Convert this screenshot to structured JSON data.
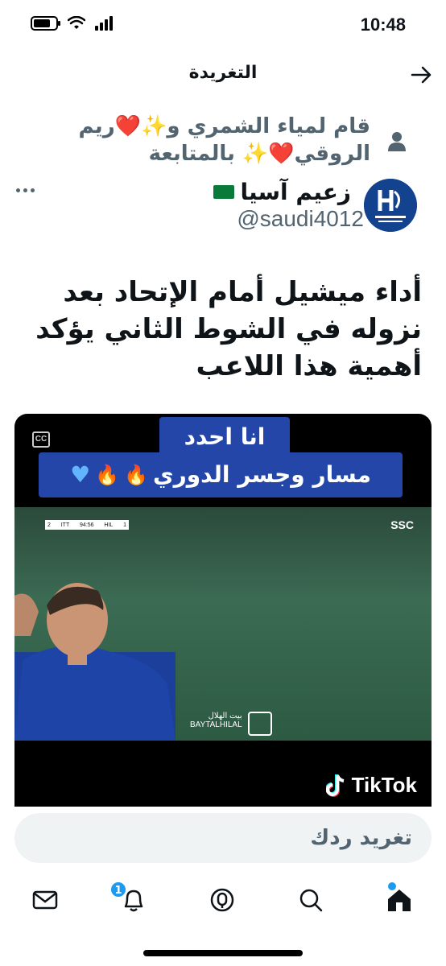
{
  "status_bar": {
    "time": "10:48"
  },
  "header": {
    "title": "التغريدة"
  },
  "social_context": {
    "text": "قام لمياء الشمري و✨❤️ريم الروقي❤️✨ بالمتابعة"
  },
  "author": {
    "name": "زعيم آسيا",
    "handle": "@saudi4012"
  },
  "tweet": {
    "text": "أداء ميشيل أمام الإتحاد بعد نزوله في الشوط الثاني يؤكد أهمية هذا اللاعب"
  },
  "media": {
    "caption_line1": "انا احدد",
    "caption_line2": "مسار وجسر الدوري",
    "tiktok_label": "TikTok",
    "cc_label": "CC",
    "scoreboard": {
      "team1": "ITT",
      "score1": "2",
      "time": "94:56",
      "team2": "HIL",
      "score2": "1"
    },
    "channel": "SSC",
    "watermark_ar": "بيت الهلال",
    "watermark_en": "BAYTALHILAL"
  },
  "reply": {
    "placeholder": "تغريد ردك"
  },
  "bottom_nav": {
    "items": [
      {
        "name": "messages",
        "icon": "mail-icon"
      },
      {
        "name": "notifications",
        "icon": "bell-icon",
        "badge": "1"
      },
      {
        "name": "spaces",
        "icon": "spaces-icon"
      },
      {
        "name": "search",
        "icon": "search-icon"
      },
      {
        "name": "home",
        "icon": "home-icon"
      }
    ]
  },
  "colors": {
    "accent": "#1d9bf0",
    "secondary_text": "#536471",
    "caption_bg": "#2346a8"
  }
}
